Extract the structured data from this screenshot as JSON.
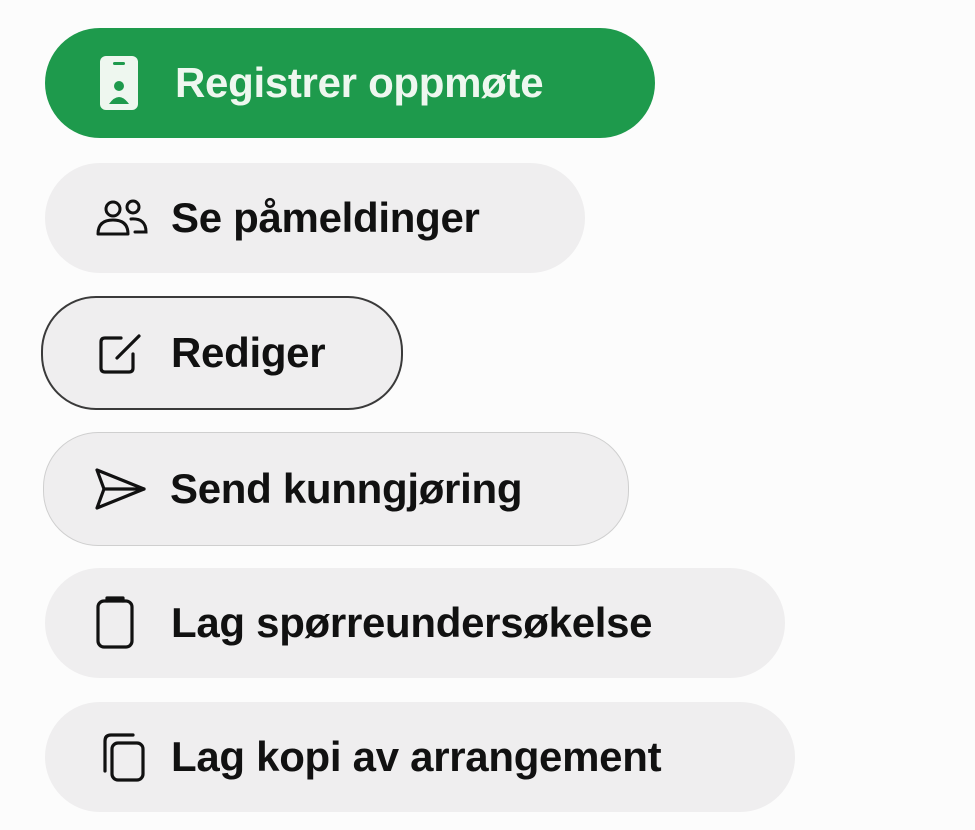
{
  "actions": [
    {
      "label": "Registrer oppmøte",
      "icon": "id-badge-icon"
    },
    {
      "label": "Se påmeldinger",
      "icon": "users-icon"
    },
    {
      "label": "Rediger",
      "icon": "edit-icon"
    },
    {
      "label": "Send kunngjøring",
      "icon": "send-icon"
    },
    {
      "label": "Lag spørreundersøkelse",
      "icon": "clipboard-icon"
    },
    {
      "label": "Lag kopi av arrangement",
      "icon": "copy-icon"
    }
  ],
  "colors": {
    "primary_bg": "#1e9a4c",
    "primary_text": "#eef7ef",
    "secondary_bg": "#efeeef",
    "text": "#111111",
    "focus_border": "#3a3a3a"
  }
}
